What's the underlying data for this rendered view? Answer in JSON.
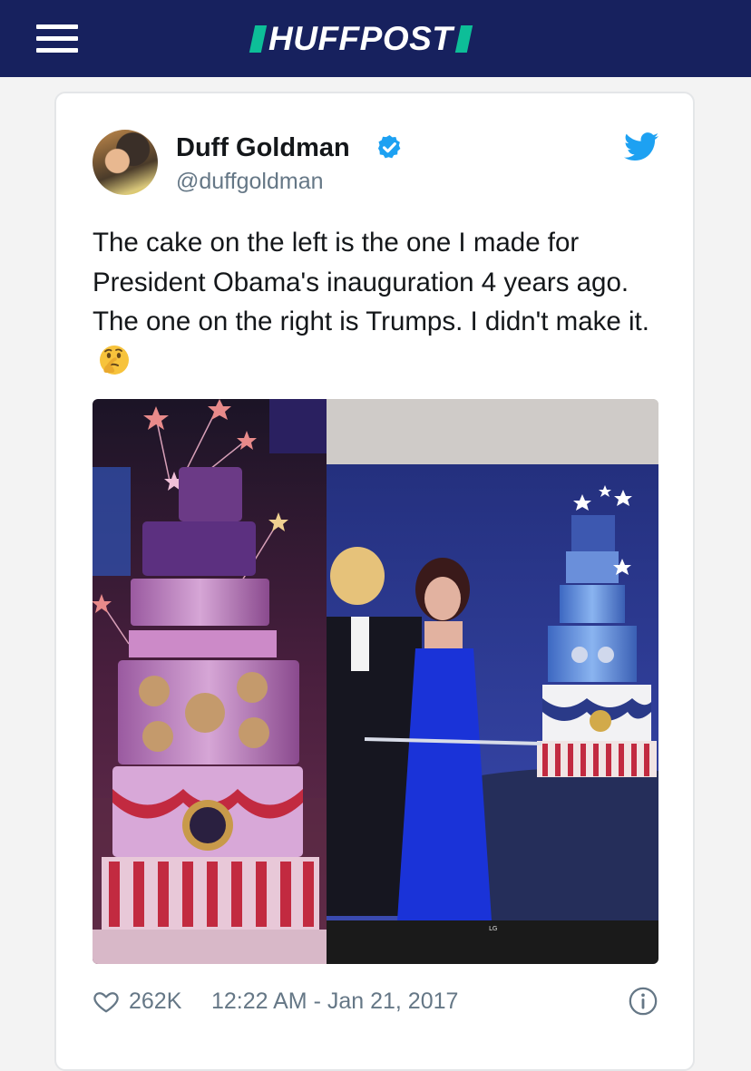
{
  "header": {
    "logo_text": "HUFFPOST",
    "menu_icon": "hamburger-menu-icon",
    "background": "#17215e",
    "accent": "#0dbe98"
  },
  "tweet": {
    "author_name": "Duff Goldman",
    "handle": "@duffgoldman",
    "verified_icon": "verified-badge-icon",
    "platform_icon": "twitter-bird-icon",
    "text": "The cake on the left is the one I made for President Obama's inauguration 4 years ago. The one on the right is Trumps. I didn't make it.",
    "emoji": "thinking-face-emoji",
    "photo_tag": "LG",
    "like_count": "262K",
    "timestamp": "12:22 AM - Jan 21, 2017",
    "info_icon": "info-icon"
  },
  "colors": {
    "twitter_blue": "#1da1f2",
    "text": "#14171a",
    "muted": "#657786"
  }
}
